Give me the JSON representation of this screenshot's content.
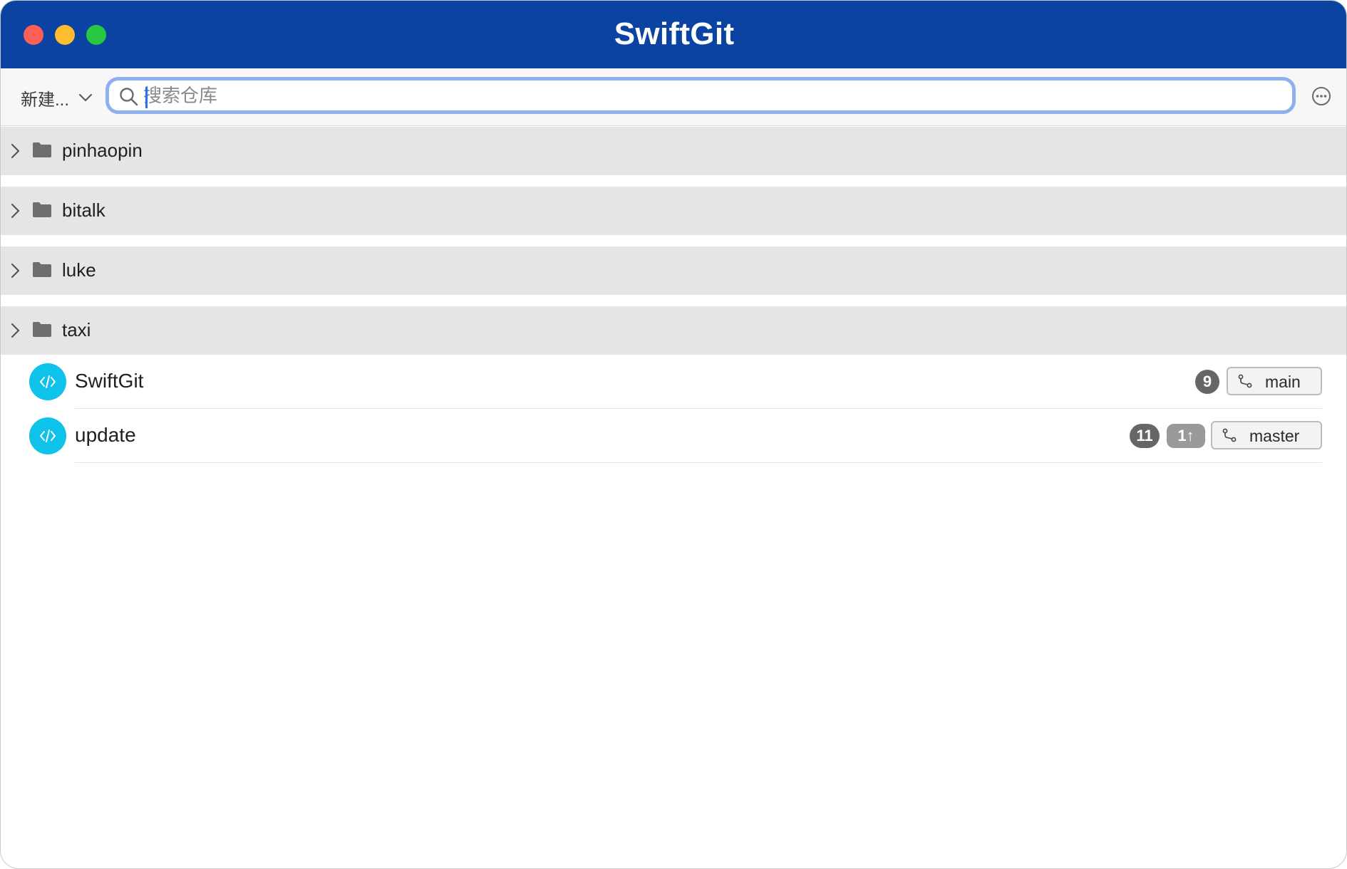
{
  "window": {
    "title": "SwiftGit"
  },
  "toolbar": {
    "new_label": "新建...",
    "search_placeholder": "搜索仓库",
    "search_value": ""
  },
  "groups": [
    {
      "label": "pinhaopin",
      "icon": "folder-icon"
    },
    {
      "label": "bitalk",
      "icon": "folder-icon"
    },
    {
      "label": "luke",
      "icon": "folder-icon"
    },
    {
      "label": "taxi",
      "icon": "folder-icon"
    }
  ],
  "repos": [
    {
      "name": "SwiftGit",
      "count": "9",
      "ahead": "",
      "branch": "main"
    },
    {
      "name": "update",
      "count": "11",
      "ahead": "1↑",
      "branch": "master"
    }
  ],
  "colors": {
    "titlebar": "#0b43a3",
    "repo_icon": "#0ec2ea",
    "group_bg": "#e5e5e5",
    "search_focus": "#8fb0ee"
  }
}
